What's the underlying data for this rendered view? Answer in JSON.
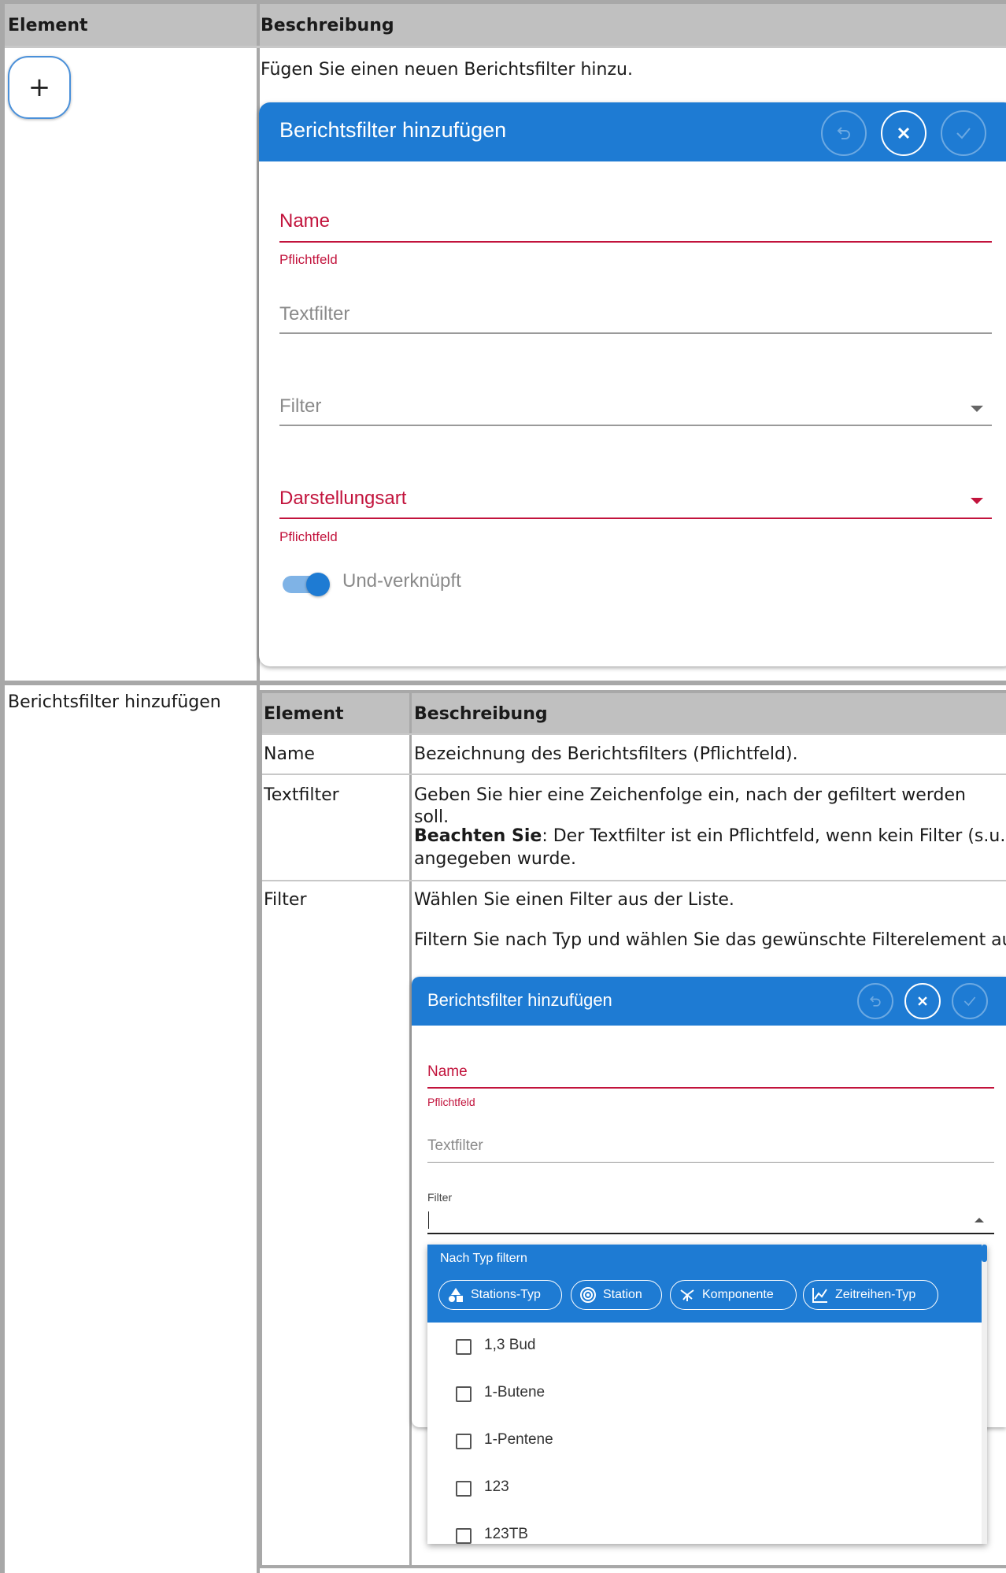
{
  "outer": {
    "header_element": "Element",
    "header_description": "Beschreibung",
    "row1_description": "Fügen Sie einen neuen Berichtsfilter hinzu.",
    "row2_element": "Berichtsfilter hinzufügen"
  },
  "plus_button_glyph": "+",
  "dialog1": {
    "title": "Berichtsfilter hinzufügen",
    "name_label": "Name",
    "name_hint": "Pflichtfeld",
    "textfilter_label": "Textfilter",
    "filter_label": "Filter",
    "darstellung_label": "Darstellungsart",
    "darstellung_hint": "Pflichtfeld",
    "toggle_label": "Und-verknüpft",
    "toggle_on": true
  },
  "inner_table": {
    "header_element": "Element",
    "header_description": "Beschreibung",
    "rows": [
      {
        "element": "Name",
        "description": "Bezeichnung des Berichtsfilters (Pflichtfeld)."
      },
      {
        "element": "Textfilter",
        "description": "Geben Sie hier eine Zeichenfolge ein, nach der gefiltert werden soll.",
        "note_bold": "Beachten Sie",
        "note_rest": ": Der Textfilter ist ein Pflichtfeld, wenn kein Filter (s.u.)",
        "note_line2": "angegeben wurde."
      },
      {
        "element": "Filter",
        "description": "Wählen Sie einen Filter aus der Liste.",
        "description2": "Filtern Sie nach Typ und wählen Sie das gewünschte Filterelement aus:"
      }
    ]
  },
  "dialog2": {
    "title": "Berichtsfilter hinzufügen",
    "name_label": "Name",
    "name_hint": "Pflichtfeld",
    "textfilter_label": "Textfilter",
    "filter_label": "Filter",
    "dropdown_header": "Nach Typ filtern",
    "chips": [
      "Stations-Typ",
      "Station",
      "Komponente",
      "Zeitreihen-Typ"
    ],
    "options": [
      "1,3 Bud",
      "1-Butene",
      "1-Pentene",
      "123",
      "123TB"
    ]
  },
  "colors": {
    "accent": "#1e7bd3",
    "error": "#c2133c",
    "header_bg": "#c0c0c0"
  }
}
